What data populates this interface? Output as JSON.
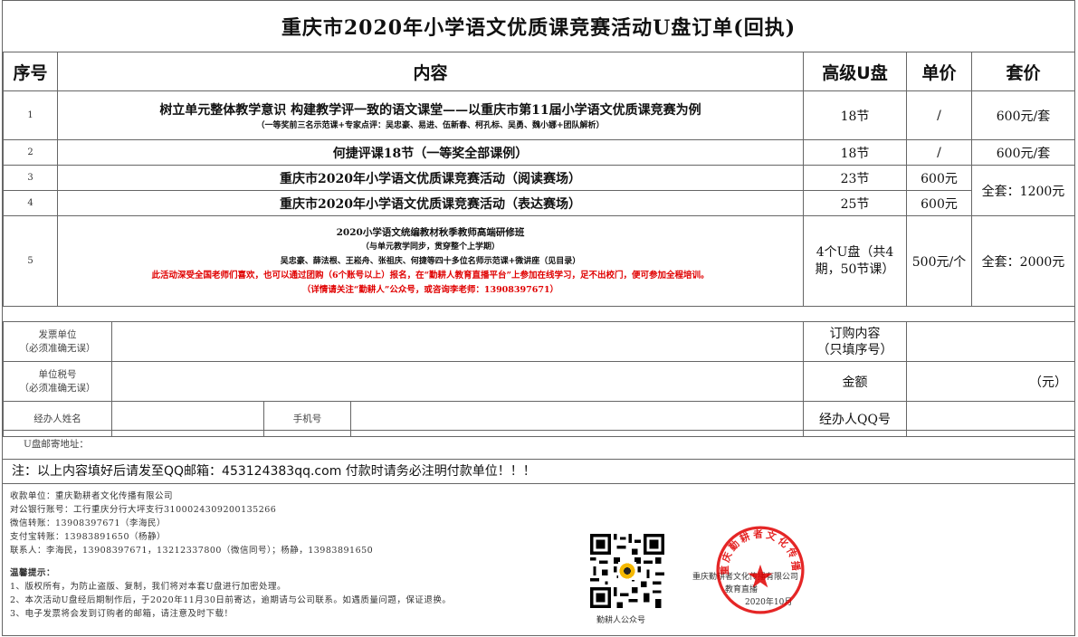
{
  "title": "重庆市2020年小学语文优质课竞赛活动U盘订单(回执)",
  "headers": {
    "no": "序号",
    "content": "内容",
    "udisk": "高级U盘",
    "price": "单价",
    "set": "套价"
  },
  "rows": [
    {
      "no": "1",
      "main": "树立单元整体教学意识 构建教学评一致的语文课堂——以重庆市第11届小学语文优质课竞赛为例",
      "sub": "（一等奖前三名示范课+专家点评：吴忠豪、易进、伍新春、柯孔标、吴勇、魏小娜+团队解析）",
      "udisk": "18节",
      "price": "/",
      "set": "600元/套"
    },
    {
      "no": "2",
      "main": "何捷评课18节（一等奖全部课例）",
      "udisk": "18节",
      "price": "/",
      "set": "600元/套"
    },
    {
      "no": "3",
      "main": "重庆市2020年小学语文优质课竞赛活动（阅读赛场）",
      "udisk": "23节",
      "price": "600元"
    },
    {
      "no": "4",
      "main": "重庆市2020年小学语文优质课竞赛活动（表达赛场）",
      "udisk": "25节",
      "price": "600元"
    },
    {
      "no": "5",
      "line1": "2020小学语文统编教材秋季教师高端研修班",
      "line2": "（与单元教学同步，贯穿整个上学期）",
      "line3": "吴忠豪、薛法根、王崧舟、张祖庆、何捷等四十多位名师示范课+微讲座（见目录）",
      "red1": "此活动深受全国老师们喜欢，也可以通过团购（6个账号以上）报名，在“勤耕人教育直播平台”上参加在线学习，足不出校门，便可参加全程培训。",
      "red2": "（详情请关注“勤耕人”公众号，或咨询李老师：13908397671）",
      "udisk": "4个U盘（共4期，50节课）",
      "price": "500元/个",
      "set": "全套：2000元"
    }
  ],
  "set_34": "全套：1200元",
  "form": {
    "invoice_unit": "发票单位",
    "invoice_unit_note": "（必须准确无误）",
    "tax_no": "单位税号",
    "tax_no_note": "（必须准确无误）",
    "handler_name": "经办人姓名",
    "phone": "手机号",
    "order_content": "订购内容",
    "order_content_note": "（只填序号）",
    "amount": "金额",
    "amount_unit": "（元）",
    "qq": "经办人QQ号",
    "address": "U盘邮寄地址："
  },
  "note": "注：以上内容填好后请发至QQ邮箱：453124383qq.com    付款时请务必注明付款单位！！！",
  "info": {
    "payee": "收款单位：重庆勤耕者文化传播有限公司",
    "account": "对公银行账号：工行重庆分行大坪支行3100024309200135266",
    "wechat": "微信转账：13908397671（李海民）",
    "alipay": "支付宝转账：13983891650（杨静）",
    "contact": "联系人：李海民，13908397671，13212337800（微信同号）；杨静，13983891650",
    "tip_title": "温馨提示：",
    "tip1": "1、版权所有，为防止盗版、复制，我们将对本套U盘进行加密处理。",
    "tip2": "2、本次活动U盘经后期制作后，于2020年11月30日前寄达，逾期请与公司联系。如遇质量问题，保证退换。",
    "tip3": "3、电子发票将会发到订购者的邮箱，请注意及时下载！"
  },
  "qr_caption": "勤耕人公众号",
  "seal_side": {
    "company": "重庆勤耕者文化传播有限公司",
    "dept": "教育直播",
    "date": "2020年10月"
  },
  "seal_text": "重庆勤耕者文化传播有限公司",
  "colors": {
    "red": "#e00000",
    "border": "#666666"
  }
}
